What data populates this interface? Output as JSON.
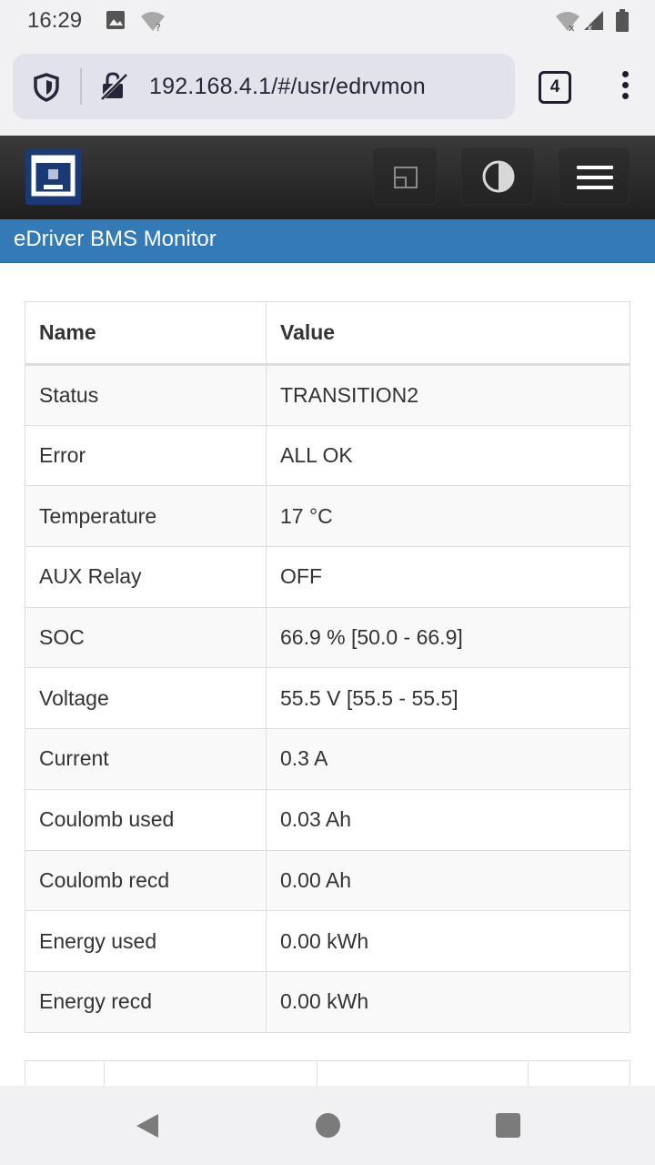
{
  "status_bar": {
    "time": "16:29"
  },
  "browser": {
    "url": "192.168.4.1/#/usr/edrvmon",
    "tab_count": "4"
  },
  "app": {
    "title": "eDriver BMS Monitor"
  },
  "table": {
    "headers": [
      "Name",
      "Value"
    ],
    "rows": [
      {
        "name": "Status",
        "value": "TRANSITION2"
      },
      {
        "name": "Error",
        "value": "ALL OK"
      },
      {
        "name": "Temperature",
        "value": "17 °C"
      },
      {
        "name": "AUX Relay",
        "value": "OFF"
      },
      {
        "name": "SOC",
        "value": "66.9 % [50.0 - 66.9]"
      },
      {
        "name": "Voltage",
        "value": "55.5 V [55.5 - 55.5]"
      },
      {
        "name": "Current",
        "value": "0.3 A"
      },
      {
        "name": "Coulomb used",
        "value": "0.03 Ah"
      },
      {
        "name": "Coulomb recd",
        "value": "0.00 Ah"
      },
      {
        "name": "Energy used",
        "value": "0.00 kWh"
      },
      {
        "name": "Energy recd",
        "value": "0.00 kWh"
      }
    ]
  },
  "colors": {
    "banner": "#337ab7",
    "header": "#222222",
    "logo": "#1b3a75"
  }
}
